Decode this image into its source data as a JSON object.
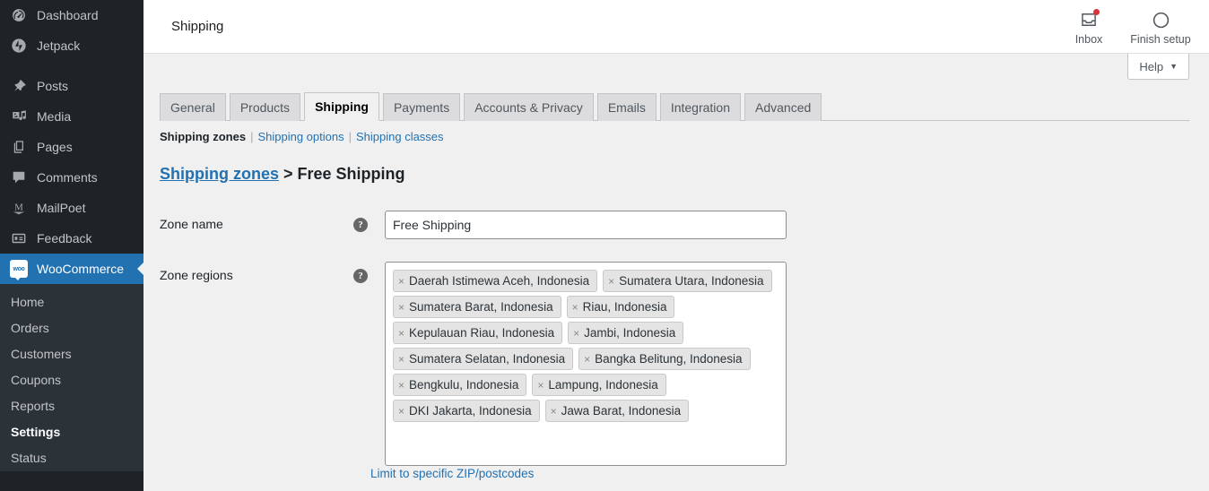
{
  "sidebar": {
    "items": [
      {
        "label": "Dashboard",
        "icon": "dashboard-icon",
        "name": "dashboard"
      },
      {
        "label": "Jetpack",
        "icon": "jetpack-icon",
        "name": "jetpack"
      },
      {
        "label": "Posts",
        "icon": "pin-icon",
        "name": "posts"
      },
      {
        "label": "Media",
        "icon": "media-icon",
        "name": "media"
      },
      {
        "label": "Pages",
        "icon": "pages-icon",
        "name": "pages"
      },
      {
        "label": "Comments",
        "icon": "comment-bubble-icon",
        "name": "comments"
      },
      {
        "label": "MailPoet",
        "icon": "mailpoet-icon",
        "name": "mailpoet"
      },
      {
        "label": "Feedback",
        "icon": "feedback-icon",
        "name": "feedback"
      },
      {
        "label": "WooCommerce",
        "icon": "woocommerce-icon",
        "name": "woocommerce"
      }
    ],
    "woo_logo_text": "woo",
    "submenu": [
      {
        "label": "Home",
        "active": false
      },
      {
        "label": "Orders",
        "active": false
      },
      {
        "label": "Customers",
        "active": false
      },
      {
        "label": "Coupons",
        "active": false
      },
      {
        "label": "Reports",
        "active": false
      },
      {
        "label": "Settings",
        "active": true
      },
      {
        "label": "Status",
        "active": false
      }
    ]
  },
  "topbar": {
    "title": "Shipping",
    "inbox_label": "Inbox",
    "finish_setup_label": "Finish setup",
    "help_label": "Help",
    "help_caret": "▼"
  },
  "tabs": [
    {
      "label": "General",
      "active": false
    },
    {
      "label": "Products",
      "active": false
    },
    {
      "label": "Shipping",
      "active": true
    },
    {
      "label": "Payments",
      "active": false
    },
    {
      "label": "Accounts & Privacy",
      "active": false
    },
    {
      "label": "Emails",
      "active": false
    },
    {
      "label": "Integration",
      "active": false
    },
    {
      "label": "Advanced",
      "active": false
    }
  ],
  "subnav": {
    "items": [
      {
        "label": "Shipping zones",
        "current": true
      },
      {
        "label": "Shipping options",
        "current": false
      },
      {
        "label": "Shipping classes",
        "current": false
      }
    ],
    "separator": "|"
  },
  "breadcrumb": {
    "link": "Shipping zones",
    "separator": ">",
    "current": "Free Shipping"
  },
  "form": {
    "zone_name_label": "Zone name",
    "zone_name_value": "Free Shipping",
    "zone_name_placeholder": "Zone name",
    "zone_regions_label": "Zone regions",
    "help_glyph": "?",
    "postcode_link": "Limit to specific ZIP/postcodes",
    "regions": [
      {
        "label": "Daerah Istimewa Aceh, Indonesia",
        "remove": "×"
      },
      {
        "label": "Sumatera Utara, Indonesia",
        "remove": "×"
      },
      {
        "label": "Sumatera Barat, Indonesia",
        "remove": "×"
      },
      {
        "label": "Riau, Indonesia",
        "remove": "×"
      },
      {
        "label": "Kepulauan Riau, Indonesia",
        "remove": "×"
      },
      {
        "label": "Jambi, Indonesia",
        "remove": "×"
      },
      {
        "label": "Sumatera Selatan, Indonesia",
        "remove": "×"
      },
      {
        "label": "Bangka Belitung, Indonesia",
        "remove": "×"
      },
      {
        "label": "Bengkulu, Indonesia",
        "remove": "×"
      },
      {
        "label": "Lampung, Indonesia",
        "remove": "×"
      },
      {
        "label": "DKI Jakarta, Indonesia",
        "remove": "×"
      },
      {
        "label": "Jawa Barat, Indonesia",
        "remove": "×"
      }
    ]
  },
  "colors": {
    "sidebar_bg": "#1d2327",
    "submenu_bg": "#2c3338",
    "accent_blue": "#2271b1",
    "page_bg": "#f0f0f1",
    "notification_red": "#d63638"
  }
}
